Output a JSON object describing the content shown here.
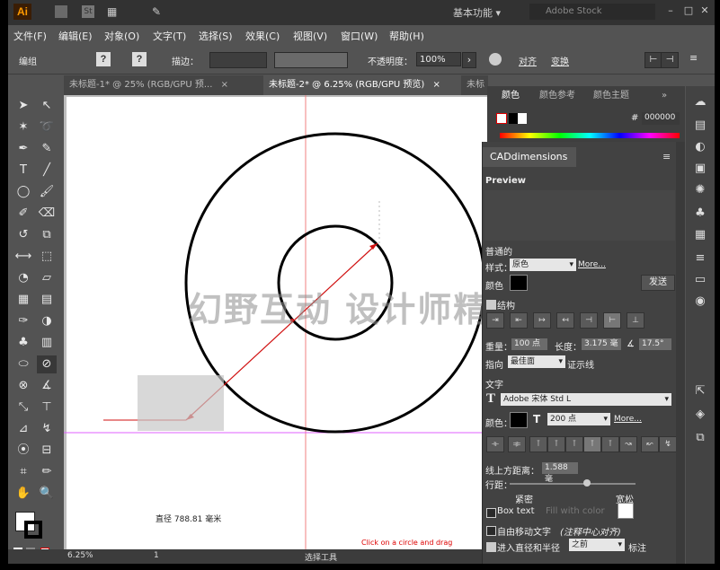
{
  "appbar": {
    "logo": "Ai",
    "workspace": "基本功能 ▾",
    "search_placeholder": "Adobe Stock"
  },
  "menu": [
    "文件(F)",
    "编辑(E)",
    "对象(O)",
    "文字(T)",
    "选择(S)",
    "效果(C)",
    "视图(V)",
    "窗口(W)",
    "帮助(H)"
  ],
  "control": {
    "label": "编组",
    "stroke_label": "描边：",
    "opacity_label": "不透明度：",
    "opacity_value": "100%",
    "align_label": "对齐",
    "transform_label": "变换",
    "question": "?"
  },
  "tabs": [
    {
      "label": "未标题-1* @ 25% (RGB/GPU 预...",
      "close": "×"
    },
    {
      "label": "未标题-2* @ 6.25% (RGB/GPU 预览)",
      "close": "×"
    },
    {
      "label": "未标",
      "close": ""
    }
  ],
  "canvas": {
    "measure_text": "直径 788.81 毫米",
    "hint_text": "Click on a circle and drag"
  },
  "status": {
    "zoom": "6.25%",
    "page": "1",
    "tool_name": "选择工具"
  },
  "color_panel": {
    "tabs": [
      "颜色",
      "颜色参考",
      "颜色主题"
    ],
    "hex": "000000"
  },
  "cad": {
    "title": "CADdimensions",
    "preview": "Preview",
    "general": "普通的",
    "style_label": "样式：",
    "style_value": "原色",
    "more": "More...",
    "color_label": "颜色",
    "send_button": "发送",
    "line_label": "结构",
    "weight_label": "重量：",
    "weight_value": "100 点",
    "length_label": "长度：",
    "length_value": "3.175 毫",
    "angle_value": "17.5°",
    "direction_label": "指向",
    "direction_value": "最佳面",
    "show_line": "证示线",
    "text_section": "文字",
    "font_value": "Adobe 宋体 Std L",
    "text_color_label": "颜色：",
    "font_size": "200 点",
    "more2": "More...",
    "baseline_label": "线上方距离：",
    "baseline_value": "1.588 毫",
    "leading_label": "行距：",
    "tight": "紧密",
    "loose": "宽松",
    "box_text": "Box text",
    "fill_with_color": "Fill with color",
    "auto_move": "自由移动文字",
    "auto_move_note": "(注释中心对齐)",
    "enter_radius": "进入直径和半径",
    "position_value": "之前",
    "annotate": "标注"
  },
  "colors": {
    "accent": "#d01010",
    "line": "#000000",
    "guide": "#e060ff"
  },
  "watermark": "幻野互动 设计师精选"
}
